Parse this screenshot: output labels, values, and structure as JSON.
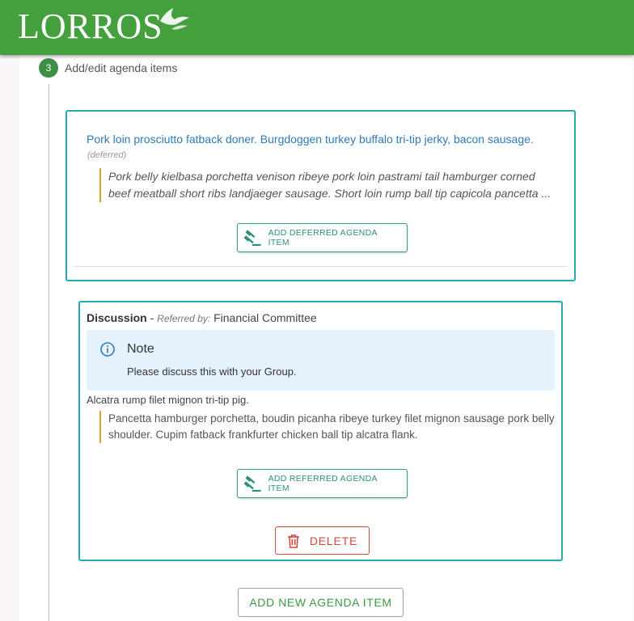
{
  "header": {
    "logo_text": "LORROS"
  },
  "step": {
    "number": "3",
    "label": "Add/edit agenda items"
  },
  "deferred": {
    "title": "Pork loin prosciutto fatback doner. Burgdoggen turkey buffalo tri-tip jerky, bacon sausage.",
    "status": "(deferred)",
    "description": "Pork belly kielbasa porchetta venison ribeye pork loin pastrami tail hamburger corned beef meatball short ribs landjaeger sausage. Short loin rump ball tip capicola pancetta ...",
    "button_label": "ADD DEFERRED AGENDA ITEM"
  },
  "referred": {
    "type": "Discussion",
    "separator": " - ",
    "referred_by_label": "Referred by:",
    "referred_by": "Financial Committee",
    "note_title": "Note",
    "note_body": "Please discuss this with your Group.",
    "title": "Alcatra rump filet mignon tri-tip pig.",
    "description": "Pancetta hamburger porchetta, boudin picanha ribeye turkey filet mignon sausage pork belly shoulder. Cupim fatback frankfurter chicken ball tip alcatra flank.",
    "button_label": "ADD REFERRED AGENDA ITEM",
    "delete_label": "DELETE"
  },
  "add_new_label": "ADD NEW AGENDA ITEM",
  "icons": {
    "gavel": "gavel-icon",
    "info": "info-icon",
    "trash": "trash-icon"
  },
  "colors": {
    "header": "#43a03d",
    "card_border": "#26a9b5",
    "link": "#2b7bb9",
    "quote_bar": "#d9a521",
    "note_bg": "#e6f2fb",
    "danger": "#d04a3c"
  }
}
